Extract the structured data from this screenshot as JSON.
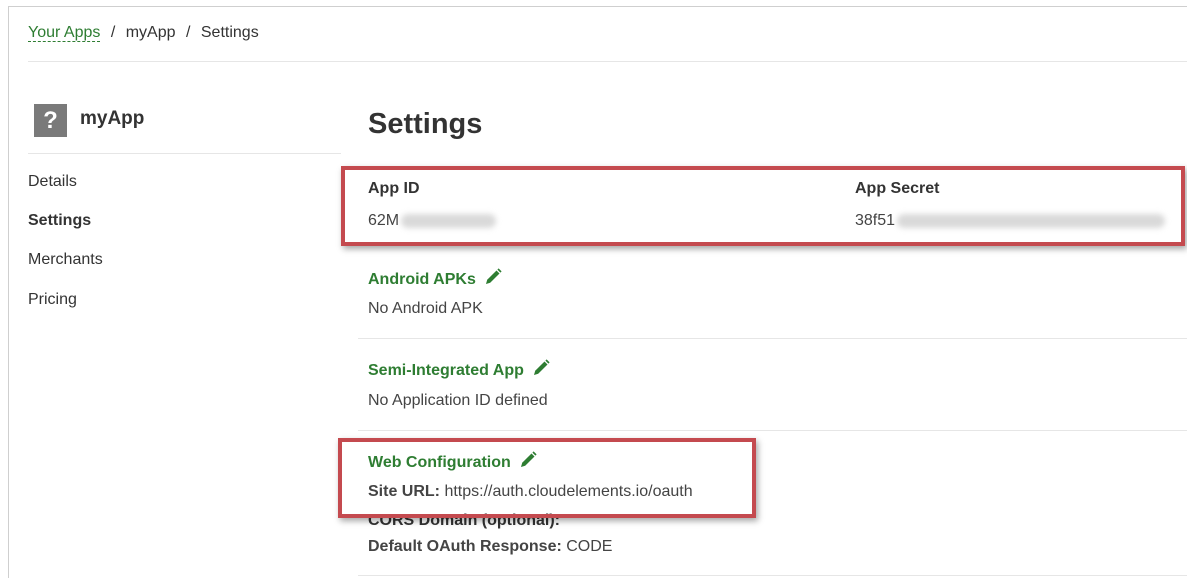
{
  "breadcrumb": {
    "root": "Your Apps",
    "separator": "/",
    "app": "myApp",
    "current": "Settings"
  },
  "sidebar": {
    "app_icon_glyph": "?",
    "app_name": "myApp",
    "items": [
      {
        "label": "Details",
        "active": false
      },
      {
        "label": "Settings",
        "active": true
      },
      {
        "label": "Merchants",
        "active": false
      },
      {
        "label": "Pricing",
        "active": false
      }
    ]
  },
  "main": {
    "title": "Settings",
    "credentials": {
      "app_id_label": "App ID",
      "app_id_prefix": "62M",
      "app_secret_label": "App Secret",
      "app_secret_prefix": "38f51"
    },
    "android": {
      "title": "Android APKs",
      "value": "No Android APK"
    },
    "semi_integrated": {
      "title": "Semi-Integrated App",
      "value": "No Application ID defined"
    },
    "web_config": {
      "title": "Web Configuration",
      "site_url_label": "Site URL:",
      "site_url_value": "https://auth.cloudelements.io/oauth",
      "cors_label": "CORS Domain (optional):",
      "oauth_label": "Default OAuth Response:",
      "oauth_value": "CODE"
    }
  },
  "colors": {
    "accent_green": "#2e7d32",
    "highlight_red": "#c44a4f"
  }
}
